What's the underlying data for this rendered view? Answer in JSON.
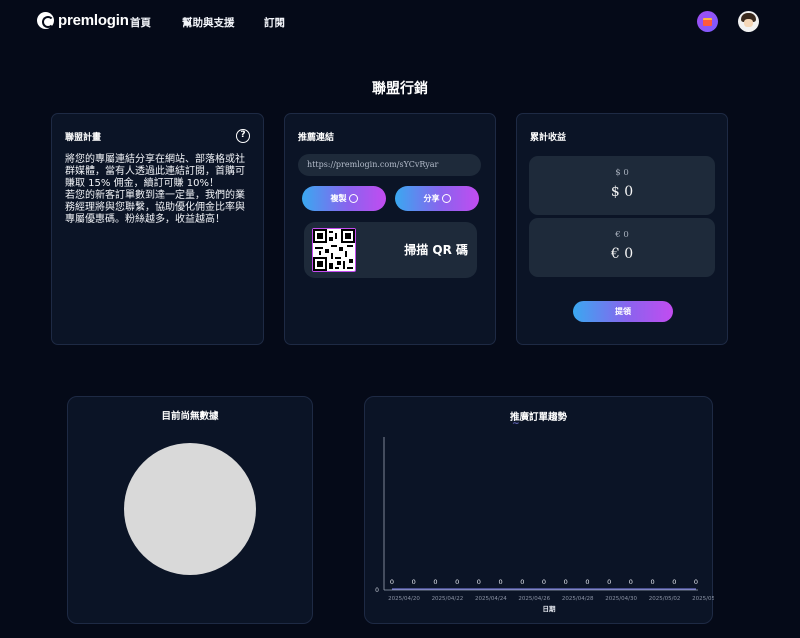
{
  "nav": {
    "logo_text": "premlogin",
    "links": [
      "首頁",
      "幫助與支援",
      "訂閱"
    ],
    "gift_icon": "gift-icon",
    "avatar_icon": "avatar-icon"
  },
  "page_title": "聯盟行銷",
  "plan": {
    "title": "聯盟計畫",
    "help_label": "?",
    "paragraph1": "將您的專屬連結分享在網站、部落格或社群媒體，當有人透過此連結訂閱，首購可賺取 15% 佣金，續訂可賺 10%！",
    "paragraph2": "若您的新客訂單數到達一定量，我們的業務經理將與您聯繫，協助優化佣金比率與專屬優惠碼。粉絲越多，收益越高！"
  },
  "referral": {
    "title": "推薦連結",
    "link": "https://premlogin.com/sYCvRyar",
    "copy_label": "複製",
    "share_label": "分享",
    "qr_label": "掃描 QR 碼"
  },
  "earnings": {
    "title": "累計收益",
    "usd_small": "$ 0",
    "usd_big": "$ 0",
    "eur_small": "€ 0",
    "eur_big": "€ 0",
    "withdraw_label": "提領"
  },
  "pie_chart": {
    "title": "目前尚無數據"
  },
  "colors": {
    "background": "#050a18",
    "card": "#0b1426",
    "accent_start": "#3aa8f0",
    "accent_end": "#c24cf0",
    "line": "#8a8bf8"
  },
  "chart_data": {
    "type": "line",
    "title": "推廣訂單趨勢",
    "xlabel": "日期",
    "ylabel": "",
    "x": [
      "2025/04/20",
      "2025/04/21",
      "2025/04/22",
      "2025/04/23",
      "2025/04/24",
      "2025/04/25",
      "2025/04/26",
      "2025/04/27",
      "2025/04/28",
      "2025/04/29",
      "2025/04/30",
      "2025/05/01",
      "2025/05/02",
      "2025/05/03",
      "2025/05/04"
    ],
    "x_tick_labels": [
      "2025/04/20",
      "2025/04/22",
      "2025/04/24",
      "2025/04/26",
      "2025/04/28",
      "2025/04/30",
      "2025/05/02",
      "2025/05/04"
    ],
    "series": [
      {
        "values": [
          0,
          0,
          0,
          0,
          0,
          0,
          0,
          0,
          0,
          0,
          0,
          0,
          0,
          0,
          0
        ]
      }
    ],
    "y_tick_labels": [
      "0"
    ],
    "grid": false
  }
}
